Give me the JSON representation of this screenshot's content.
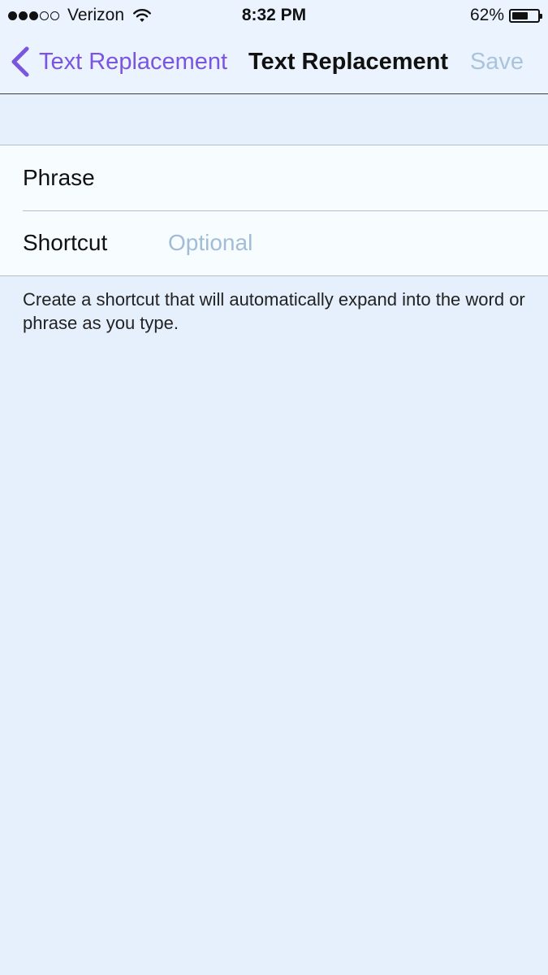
{
  "status_bar": {
    "signal_full": 3,
    "signal_total": 5,
    "carrier": "Verizon",
    "time": "8:32 PM",
    "battery_percent": "62%",
    "battery_level": 0.62,
    "wifi_icon": "wifi-icon"
  },
  "nav_bar": {
    "back_label": "Text Replacement",
    "back_icon": "chevron-left-icon",
    "title": "Text Replacement",
    "save_label": "Save",
    "accent_color": "#7b55e0",
    "disabled_color": "#a9c4dc"
  },
  "form": {
    "phrase": {
      "label": "Phrase",
      "value": "",
      "placeholder": ""
    },
    "shortcut": {
      "label": "Shortcut",
      "value": "",
      "placeholder": "Optional"
    }
  },
  "footer_note": "Create a shortcut that will automatically expand into the word or phrase as you type."
}
